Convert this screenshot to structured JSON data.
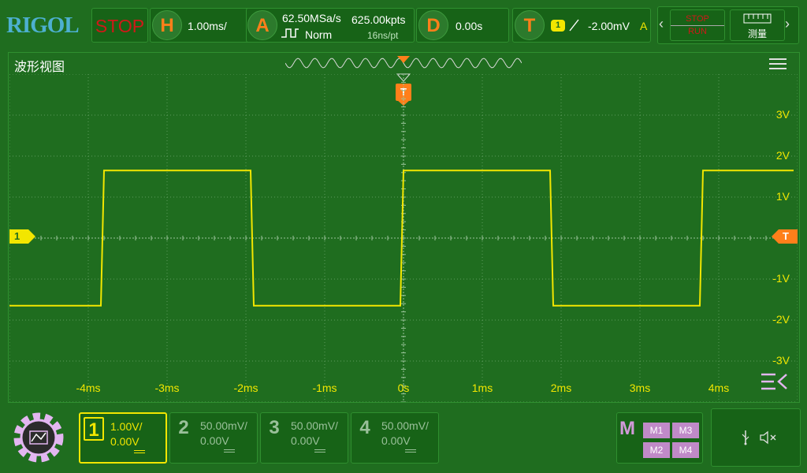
{
  "brand": "RIGOL",
  "run_state": "STOP",
  "horizontal": {
    "key": "H",
    "scale": "1.00ms/"
  },
  "acquire": {
    "key": "A",
    "sample_rate": "62.50MSa/s",
    "memory_depth": "625.00kpts",
    "mode": "Norm",
    "sample_interval": "16ns/pt"
  },
  "delay": {
    "key": "D",
    "value": "0.00s"
  },
  "trigger": {
    "key": "T",
    "source": "1",
    "slope": "rising",
    "level": "-2.00mV",
    "sweep": "A"
  },
  "toolbar": {
    "stop_label": "STOP",
    "run_label": "RUN",
    "measure_label": "测量"
  },
  "waveform_view": {
    "title": "波形视图",
    "x_ticks": [
      "-4ms",
      "-3ms",
      "-2ms",
      "-1ms",
      "0s",
      "1ms",
      "2ms",
      "3ms",
      "4ms"
    ],
    "y_ticks": [
      "3V",
      "2V",
      "1V",
      "-1V",
      "-2V",
      "-3V"
    ],
    "ch1_marker": "1",
    "trigger_marker": "T"
  },
  "chart_data": {
    "type": "line",
    "title": "",
    "xlabel": "",
    "ylabel": "",
    "series": [
      {
        "name": "",
        "x": [
          -5.0,
          -3.84,
          -3.8,
          -1.94,
          -1.9,
          -0.04,
          0.0,
          1.86,
          1.9,
          3.76,
          3.8,
          4.95
        ],
        "y": [
          -1.65,
          -1.65,
          1.65,
          1.65,
          -1.65,
          -1.65,
          1.65,
          1.65,
          -1.65,
          -1.65,
          1.65,
          1.65
        ]
      }
    ],
    "xlim": [
      -5,
      5
    ],
    "ylim": [
      -4,
      4
    ],
    "x_unit": "ms",
    "y_unit": "V",
    "grid": true,
    "color": "#f2e600"
  },
  "channels": [
    {
      "num": "1",
      "scale": "1.00V/",
      "offset": "0.00V",
      "active": true
    },
    {
      "num": "2",
      "scale": "50.00mV/",
      "offset": "0.00V",
      "active": false
    },
    {
      "num": "3",
      "scale": "50.00mV/",
      "offset": "0.00V",
      "active": false
    },
    {
      "num": "4",
      "scale": "50.00mV/",
      "offset": "0.00V",
      "active": false
    }
  ],
  "math": {
    "label": "M",
    "items": [
      "M1",
      "M3",
      "M2",
      "M4"
    ]
  },
  "colors": {
    "ch1": "#f2e600",
    "trigger": "#ff7f1a",
    "background": "#1f6d1f",
    "math": "#c08ac8",
    "brand": "#4db0d0",
    "stop": "#d01818"
  }
}
